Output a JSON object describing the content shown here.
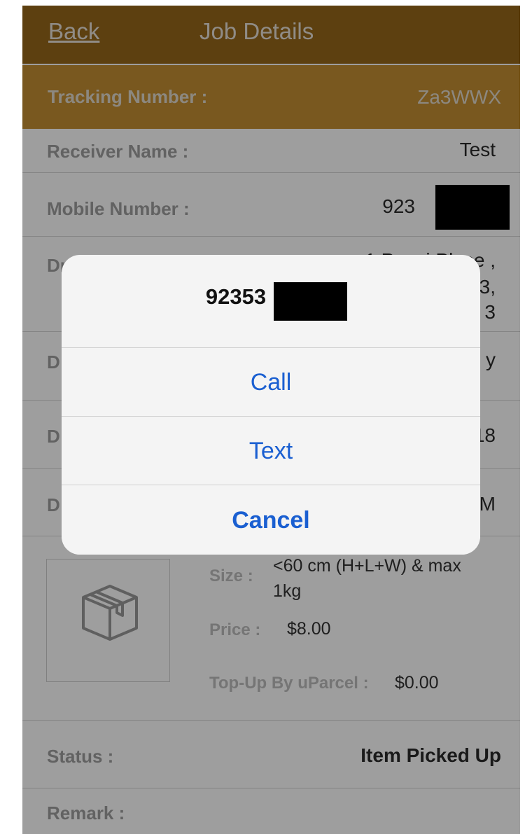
{
  "nav": {
    "back_label": "Back",
    "title": "Job Details"
  },
  "tracking": {
    "label": "Tracking Number :",
    "value": "Za3WWX"
  },
  "rows": {
    "receiver": {
      "label": "Receiver Name :",
      "value": "Test"
    },
    "mobile": {
      "label": "Mobile Number :",
      "value": "923"
    },
    "drop_partial": {
      "label": "Dr",
      "line1": "1 Pensi Place ,",
      "line2": "3,",
      "line3": "3"
    },
    "row_d1": {
      "label": "D",
      "value": "y"
    },
    "row_d2": {
      "label": "D",
      "value": "18"
    },
    "row_d3": {
      "label": "D",
      "value": "M"
    }
  },
  "parcel": {
    "icon": "box-icon",
    "size_label": "Size :",
    "size_value_line1": "<60 cm (H+L+W) & max",
    "size_value_line2": "1kg",
    "price_label": "Price :",
    "price_value": "$8.00",
    "topup_label": "Top-Up By uParcel :",
    "topup_value": "$0.00"
  },
  "status": {
    "label": "Status :",
    "value": "Item Picked Up"
  },
  "remark": {
    "label": "Remark :"
  },
  "alert": {
    "title": "92353",
    "call_label": "Call",
    "text_label": "Text",
    "cancel_label": "Cancel"
  },
  "colors": {
    "nav_bg": "#97681a",
    "tracking_bg": "#c48e32",
    "alert_button": "#1a5fd1"
  }
}
